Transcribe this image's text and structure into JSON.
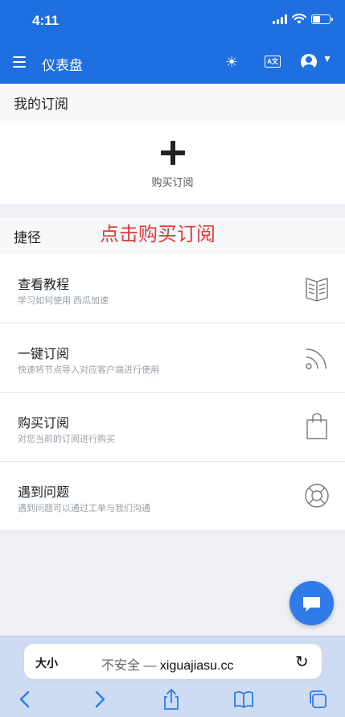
{
  "status": {
    "time": "4:11"
  },
  "app_bar": {
    "title": "仪表盘",
    "translate_label": "A文"
  },
  "subscription": {
    "header": "我的订阅",
    "buy_label": "购买订阅"
  },
  "shortcuts": {
    "header": "捷径",
    "annotation": "点击购买订阅",
    "items": [
      {
        "title": "查看教程",
        "desc": "学习如何使用 西瓜加速",
        "icon": "book-icon"
      },
      {
        "title": "一键订阅",
        "desc": "快速将节点导入对应客户端进行使用",
        "icon": "rss-icon"
      },
      {
        "title": "购买订阅",
        "desc": "对您当前的订阅进行购买",
        "icon": "shopping-bag-icon"
      },
      {
        "title": "遇到问题",
        "desc": "遇到问题可以通过工单与我们沟通",
        "icon": "lifebuoy-icon"
      }
    ]
  },
  "browser": {
    "text_size": "大小",
    "insecure": "不安全 — ",
    "host": "xiguajiasu.cc"
  },
  "colors": {
    "primary": "#1f6fe0",
    "annotation": "#e23a3a",
    "browser_bar": "#cddcf2"
  }
}
